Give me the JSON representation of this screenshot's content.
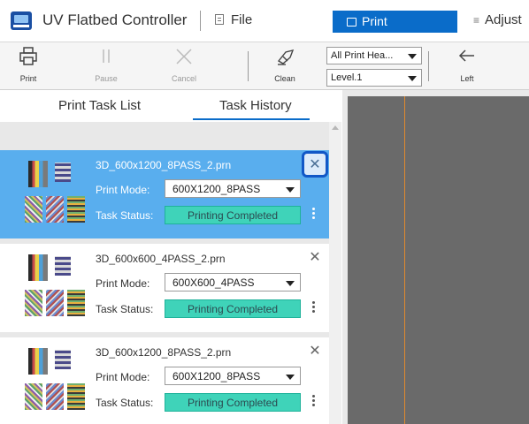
{
  "app": {
    "title": "UV Flatbed Controller",
    "icon": "printer-app-icon"
  },
  "menu": {
    "file_label": "File",
    "print_tab_label": "Print",
    "adjust_tab_label": "Adjust"
  },
  "toolbar": {
    "print_label": "Print",
    "pause_label": "Pause",
    "cancel_label": "Cancel",
    "clean_label": "Clean",
    "head_select": "All Print Hea...",
    "level_select": "Level.1",
    "left_label": "Left"
  },
  "tasks": {
    "list_tab": "Print Task List",
    "history_tab": "Task History",
    "mode_label": "Print Mode:",
    "status_label": "Task Status:",
    "items": [
      {
        "file": "3D_600x1200_8PASS_2.prn",
        "mode": "600X1200_8PASS",
        "status": "Printing Completed",
        "selected": true
      },
      {
        "file": "3D_600x600_4PASS_2.prn",
        "mode": "600X600_4PASS",
        "status": "Printing Completed",
        "selected": false
      },
      {
        "file": "3D_600x1200_8PASS_2.prn",
        "mode": "600X1200_8PASS",
        "status": "Printing Completed",
        "selected": false
      }
    ]
  },
  "colors": {
    "accent": "#0a6cc9",
    "selected_row": "#59aeee",
    "status_green": "#3fd3b9",
    "focus_ring": "#1158c7",
    "canvas_line": "#e08a2e"
  }
}
